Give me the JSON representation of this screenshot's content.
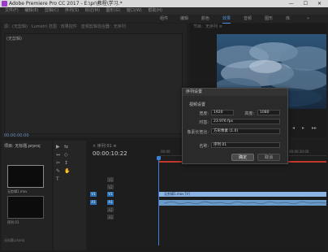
{
  "window": {
    "title": "Adobe Premiere Pro CC 2017 - E:\\pr\\教程\\学习.*",
    "controls": "—  ☐  ✕"
  },
  "menu": [
    "文件(F)",
    "编辑(E)",
    "剪辑(C)",
    "序列(S)",
    "标记(M)",
    "图形(G)",
    "窗口(W)",
    "帮助(H)"
  ],
  "workspaces": [
    "组件",
    "编辑",
    "颜色",
    "效果",
    "音频",
    "图形",
    "库"
  ],
  "source_panel": {
    "tabs": "源：(无剪辑)　Lumetri 范围　效果控件　音频剪辑混合器：无序列",
    "meta": "(无剪辑)",
    "timecode": "00:00:00:00"
  },
  "program_panel": {
    "header": "节目：无序列 ≡"
  },
  "project_panel": {
    "header": "项目: 无标题.prproj",
    "clip1": "无剪辑1.mov",
    "clip2": "序列 01",
    "footer": "无标题.prproj"
  },
  "tools": [
    "▶",
    "⇆",
    "↔",
    "◇",
    "✂",
    "↕",
    "✎",
    "✋",
    "T"
  ],
  "timeline": {
    "seq_label": "× 序列 01 ≡",
    "timecode": "00:00:10:22",
    "tracks": [
      {
        "name": "V3"
      },
      {
        "name": "V2"
      },
      {
        "name": "V1"
      },
      {
        "name": "A1"
      },
      {
        "name": "A2"
      },
      {
        "name": "A3"
      }
    ],
    "video_clip": "无剪辑1.mov [V]",
    "ruler_marks": [
      "00:00",
      "00:00:15:00",
      "00:00:30:00"
    ]
  },
  "dialog": {
    "title": "序列设置",
    "section": "视频设置",
    "width_label": "宽度:",
    "width_value": "1920",
    "height_label": "高度:",
    "height_value": "1080",
    "fps_label": "时基:",
    "fps_value": "23.976 fps",
    "par_label": "像素长宽比:",
    "par_value": "方形像素 (1.0)",
    "name_label": "名称:",
    "name_value": "序列 01",
    "ok": "确定",
    "cancel": "取消"
  },
  "colors": {
    "accent": "#4f8fd6",
    "track_active": "#2a6fb2",
    "clip_video": "#8ab4e4",
    "playhead": "#3b7fd6",
    "render_bar": "#c0392b"
  }
}
